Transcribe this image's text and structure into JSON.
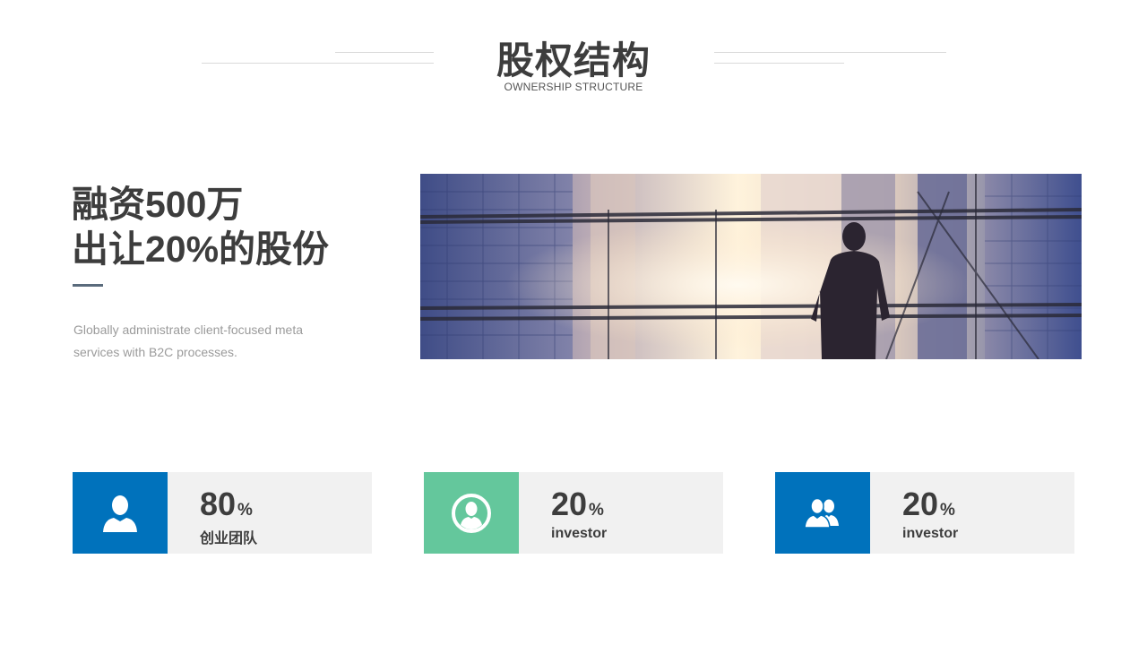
{
  "header": {
    "title": "股权结构",
    "subtitle": "OWNERSHIP STRUCTURE"
  },
  "intro": {
    "headline_line1": "融资500万",
    "headline_line2": "出让20%的股份",
    "description": "Globally administrate client-focused meta services with B2C processes."
  },
  "photo": {
    "subject": "businessman silhouette in front of city skyscrapers"
  },
  "stats": [
    {
      "value": "80",
      "unit": "%",
      "label": "创业团队",
      "icon": "person-icon",
      "color": "#0072bc"
    },
    {
      "value": "20",
      "unit": "%",
      "label": "investor",
      "icon": "user-circle-icon",
      "color": "#64c79c"
    },
    {
      "value": "20",
      "unit": "%",
      "label": "investor",
      "icon": "group-icon",
      "color": "#0072bc"
    }
  ]
}
